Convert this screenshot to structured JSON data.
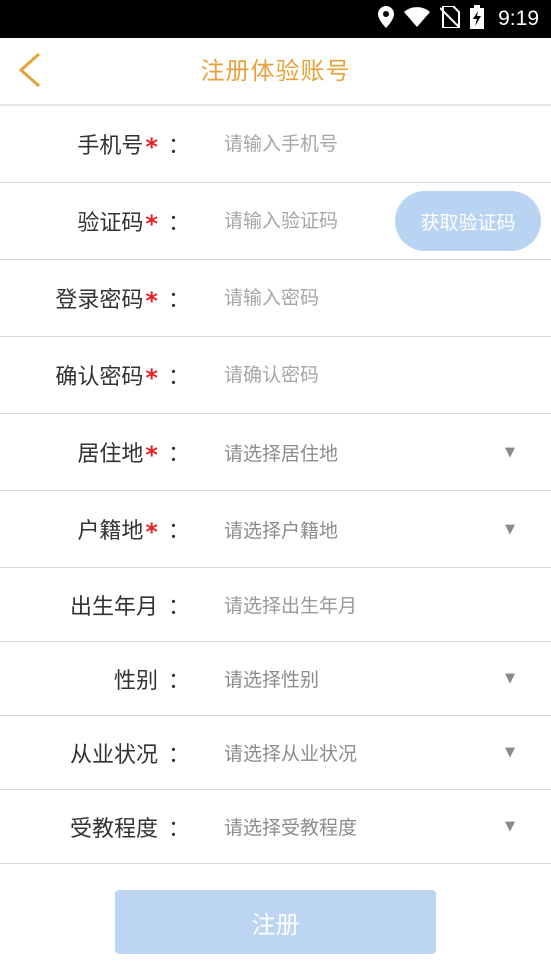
{
  "status_bar": {
    "time": "9:19",
    "icons": [
      "location-icon",
      "wifi-icon",
      "no-sim-icon",
      "battery-charging-icon"
    ]
  },
  "header": {
    "title": "注册体验账号",
    "back_icon": "chevron-left-icon",
    "accent_color": "#e6a23c"
  },
  "form": {
    "required_mark": "*",
    "colon": "：",
    "phone": {
      "label": "手机号",
      "placeholder": "请输入手机号"
    },
    "code": {
      "label": "验证码",
      "placeholder": "请输入验证码",
      "button": "获取验证码"
    },
    "password": {
      "label": "登录密码",
      "placeholder": "请输入密码"
    },
    "confirm": {
      "label": "确认密码",
      "placeholder": "请确认密码"
    },
    "residence": {
      "label": "居住地",
      "value": "请选择居住地"
    },
    "hukou": {
      "label": "户籍地",
      "value": "请选择户籍地"
    },
    "birth": {
      "label": "出生年月",
      "value": "请选择出生年月"
    },
    "gender": {
      "label": "性别",
      "value": "请选择性别"
    },
    "employment": {
      "label": "从业状况",
      "value": "请选择从业状况"
    },
    "education": {
      "label": "受教程度",
      "value": "请选择受教程度"
    },
    "caret": "▼"
  },
  "submit": {
    "label": "注册",
    "color": "#bcd5f3"
  }
}
